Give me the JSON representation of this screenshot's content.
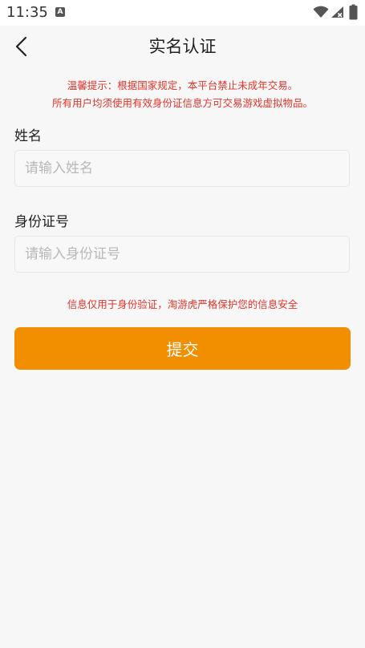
{
  "status_bar": {
    "time": "11:35",
    "notification_letter": "A"
  },
  "header": {
    "title": "实名认证"
  },
  "notice": {
    "line1": "温馨提示：根据国家规定，本平台禁止未成年交易。",
    "line2": "所有用户均须使用有效身份证信息方可交易游戏虚拟物品。"
  },
  "form": {
    "name_label": "姓名",
    "name_value": "",
    "name_placeholder": "请输入姓名",
    "id_label": "身份证号",
    "id_value": "",
    "id_placeholder": "请输入身份证号"
  },
  "privacy_note": "信息仅用于身份验证，淘游虎严格保护您的信息安全",
  "submit_label": "提交",
  "colors": {
    "accent": "#f28f00",
    "warning_text": "#e0352b",
    "background": "#f7f7f7"
  },
  "icons": {
    "back": "chevron-left-icon",
    "wifi": "wifi-icon",
    "signal": "signal-icon",
    "battery": "battery-icon"
  }
}
